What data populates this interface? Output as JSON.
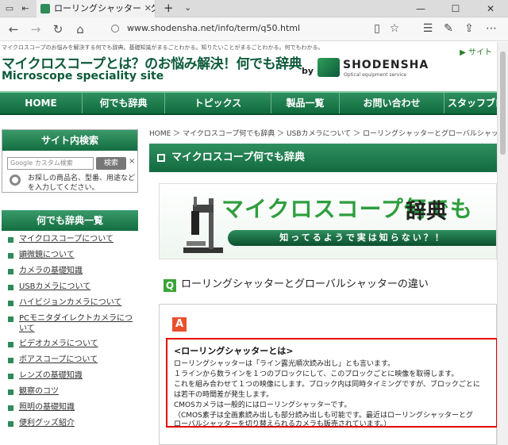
{
  "browser": {
    "tab_title": "ローリングシャッターとグローバ",
    "url": "www.shodensha.net/info/term/q50.html"
  },
  "site": {
    "description": "マイクロスコープのお悩みを解決する何でも辞典。基礎知識がまるごとわかる。知りたいことがまるごとわかる。何でもわかる。",
    "top_link": "サイト",
    "title_jp": "マイクロスコープとは？のお悩み解決！何でも辞典",
    "title_en": "Microscope speciality site",
    "by": "by",
    "brand": "SHODENSHA",
    "brand_sub": "Optical equipment service"
  },
  "menu": [
    "HOME",
    "何でも辞典",
    "トピックス",
    "製品一覧",
    "お問い合わせ",
    "スタッフブロ"
  ],
  "sidebar": {
    "search": {
      "heading": "サイト内検索",
      "placeholder": "Google カスタム検索",
      "button": "検索",
      "clear": "×",
      "hint": "お探しの商品名、型番、用途などを入力してください。"
    },
    "dictionary": {
      "heading": "何でも辞典一覧",
      "items": [
        "マイクロスコープについて",
        "顕微鏡について",
        "カメラの基礎知識",
        "USBカメラについて",
        "ハイビジョンカメラについて",
        "PCモニタダイレクトカメラについて",
        "ビデオカメラについて",
        "ボアスコープについて",
        "レンズの基礎知識",
        "観察のコツ",
        "照明の基礎知識",
        "便利グッズ紹介"
      ]
    }
  },
  "breadcrumb": "HOME ＞ マイクロスコープ何でも辞典 ＞ USBカメラについて ＞ ローリングシャッターとグローバルシャッター",
  "main": {
    "heading": "マイクロスコープ何でも辞典",
    "banner": {
      "title": "マイクロスコープ何でも",
      "title2": "辞典",
      "tagline": "知ってるようで実は知らない？！"
    },
    "question_badge": "Q",
    "question": "ローリングシャッターとグローバルシャッターの違い",
    "answer_badge": "A",
    "answer_title": "<ローリングシャッターとは>",
    "answer_lines": [
      "ローリングシャッターは「ライン露光順次読み出し」とも言います。",
      "１ラインから数ラインを１つのブロックにして、このブロックごとに映像を取得します。",
      "これを組み合わせて１つの映像にします。ブロック内は同時タイミングですが、ブロックごとに",
      "は若干の時間差が発生します。",
      "CMOSカメラは一般的にはローリングシャッターです。",
      "（CMOS素子は全画素読み出しも部分読み出しも可能です。最近はローリングシャッターとグ",
      "ローバルシャッターを切り替えられるカメラも販売されています。）"
    ]
  },
  "colors": {
    "brand_green": "#106a3e",
    "answer_border": "#e60000",
    "q_badge": "#3aa53a",
    "a_badge": "#e8502c"
  }
}
